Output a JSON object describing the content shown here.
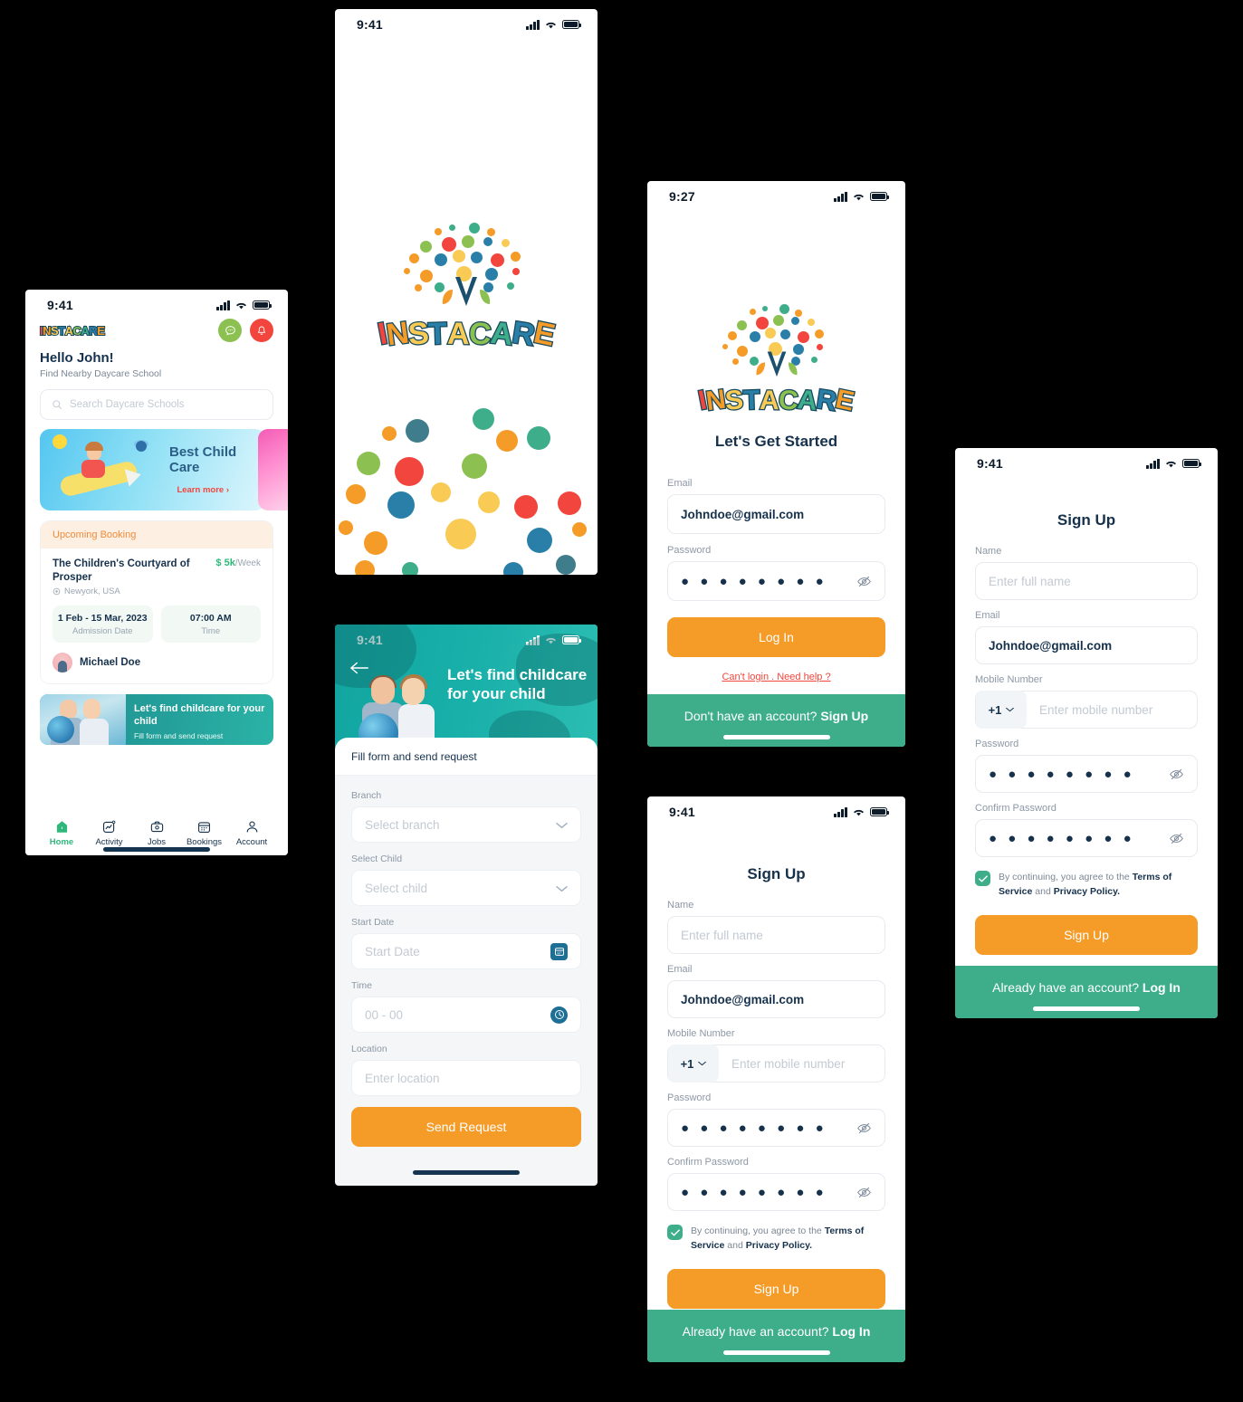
{
  "brand": {
    "name": "INSTACARE",
    "letters": [
      "I",
      "N",
      "S",
      "T",
      "A",
      "C",
      "A",
      "R",
      "E"
    ]
  },
  "colors": {
    "orange": "#F59B28",
    "red": "#F2453D",
    "green": "#3EAE8A",
    "navy": "#16314c",
    "teal": "#17ABA4",
    "yellow": "#F9CB55",
    "blue": "#2A7FA8",
    "lime": "#8CC152"
  },
  "home": {
    "status": {
      "time": "9:41"
    },
    "greeting": "Hello John!",
    "subtitle": "Find Nearby Daycare School",
    "search": {
      "placeholder": "Search Daycare Schools",
      "icon": "search-icon"
    },
    "header_icons": [
      {
        "name": "chat-icon",
        "glyph": "●"
      },
      {
        "name": "bell-icon",
        "glyph": "●"
      }
    ],
    "banner": {
      "title": "Best Child Care",
      "link": "Learn more",
      "chevron": "›"
    },
    "booking": {
      "header": "Upcoming Booking",
      "name": "The Children's Courtyard of Prosper",
      "price": "$ 5k",
      "price_unit": "/Week",
      "location": "Newyork, USA",
      "chips": [
        {
          "value": "1 Feb - 15 Mar, 2023",
          "label": "Admission Date"
        },
        {
          "value": "07:00 AM",
          "label": "Time"
        }
      ],
      "person": "Michael Doe"
    },
    "promo": {
      "title": "Let's find childcare for your child",
      "subtitle": "Fill form and send request"
    },
    "tabs": [
      {
        "label": "Home",
        "icon": "home-icon",
        "active": true
      },
      {
        "label": "Activity",
        "icon": "activity-icon",
        "active": false
      },
      {
        "label": "Jobs",
        "icon": "briefcase-icon",
        "active": false
      },
      {
        "label": "Bookings",
        "icon": "calendar-icon",
        "active": false
      },
      {
        "label": "Account",
        "icon": "person-icon",
        "active": false
      }
    ]
  },
  "splash": {
    "status": {
      "time": "9:41"
    }
  },
  "request_form": {
    "status": {
      "time": "9:41"
    },
    "back_icon": "back-arrow-icon",
    "hero_title": "Let's find childcare for your child",
    "sheet_title": "Fill form and send request",
    "fields": [
      {
        "label": "Branch",
        "placeholder": "Select branch",
        "icon": "chevron-down-icon"
      },
      {
        "label": "Select Child",
        "placeholder": "Select child",
        "icon": "chevron-down-icon"
      },
      {
        "label": "Start Date",
        "placeholder": "Start Date",
        "icon": "calendar-icon"
      },
      {
        "label": "Time",
        "placeholder": "00 - 00",
        "icon": "clock-icon"
      },
      {
        "label": "Location",
        "placeholder": "Enter location",
        "icon": ""
      }
    ],
    "submit": "Send Request"
  },
  "login": {
    "status": {
      "time": "9:27"
    },
    "title": "Let's Get Started",
    "email": {
      "label": "Email",
      "value": "Johndoe@gmail.com"
    },
    "password": {
      "label": "Password",
      "value": "● ● ● ● ● ● ● ●",
      "eye_icon": "eye-off-icon"
    },
    "submit": "Log In",
    "help": "Can't login . Need help ?",
    "footer": {
      "text": "Don't have an account?",
      "action": "Sign Up"
    }
  },
  "signup": {
    "status": {
      "time": "9:41"
    },
    "title": "Sign Up",
    "name": {
      "label": "Name",
      "placeholder": "Enter full name"
    },
    "email": {
      "label": "Email",
      "value": "Johndoe@gmail.com"
    },
    "mobile": {
      "label": "Mobile Number",
      "country_code": "+1",
      "placeholder": "Enter mobile number",
      "icon": "chevron-down-icon"
    },
    "password": {
      "label": "Password",
      "value": "● ● ● ● ● ● ● ●",
      "eye_icon": "eye-off-icon"
    },
    "confirm_password": {
      "label": "Confirm Password",
      "value": "● ● ● ● ● ● ● ●",
      "eye_icon": "eye-off-icon"
    },
    "terms": {
      "prefix": "By continuing, you agree to the ",
      "tos": "Terms of Service",
      "mid": " and ",
      "pp": "Privacy Policy.",
      "checked": true
    },
    "submit": "Sign Up",
    "footer": {
      "text": "Already have an account?",
      "action": "Log In"
    }
  }
}
